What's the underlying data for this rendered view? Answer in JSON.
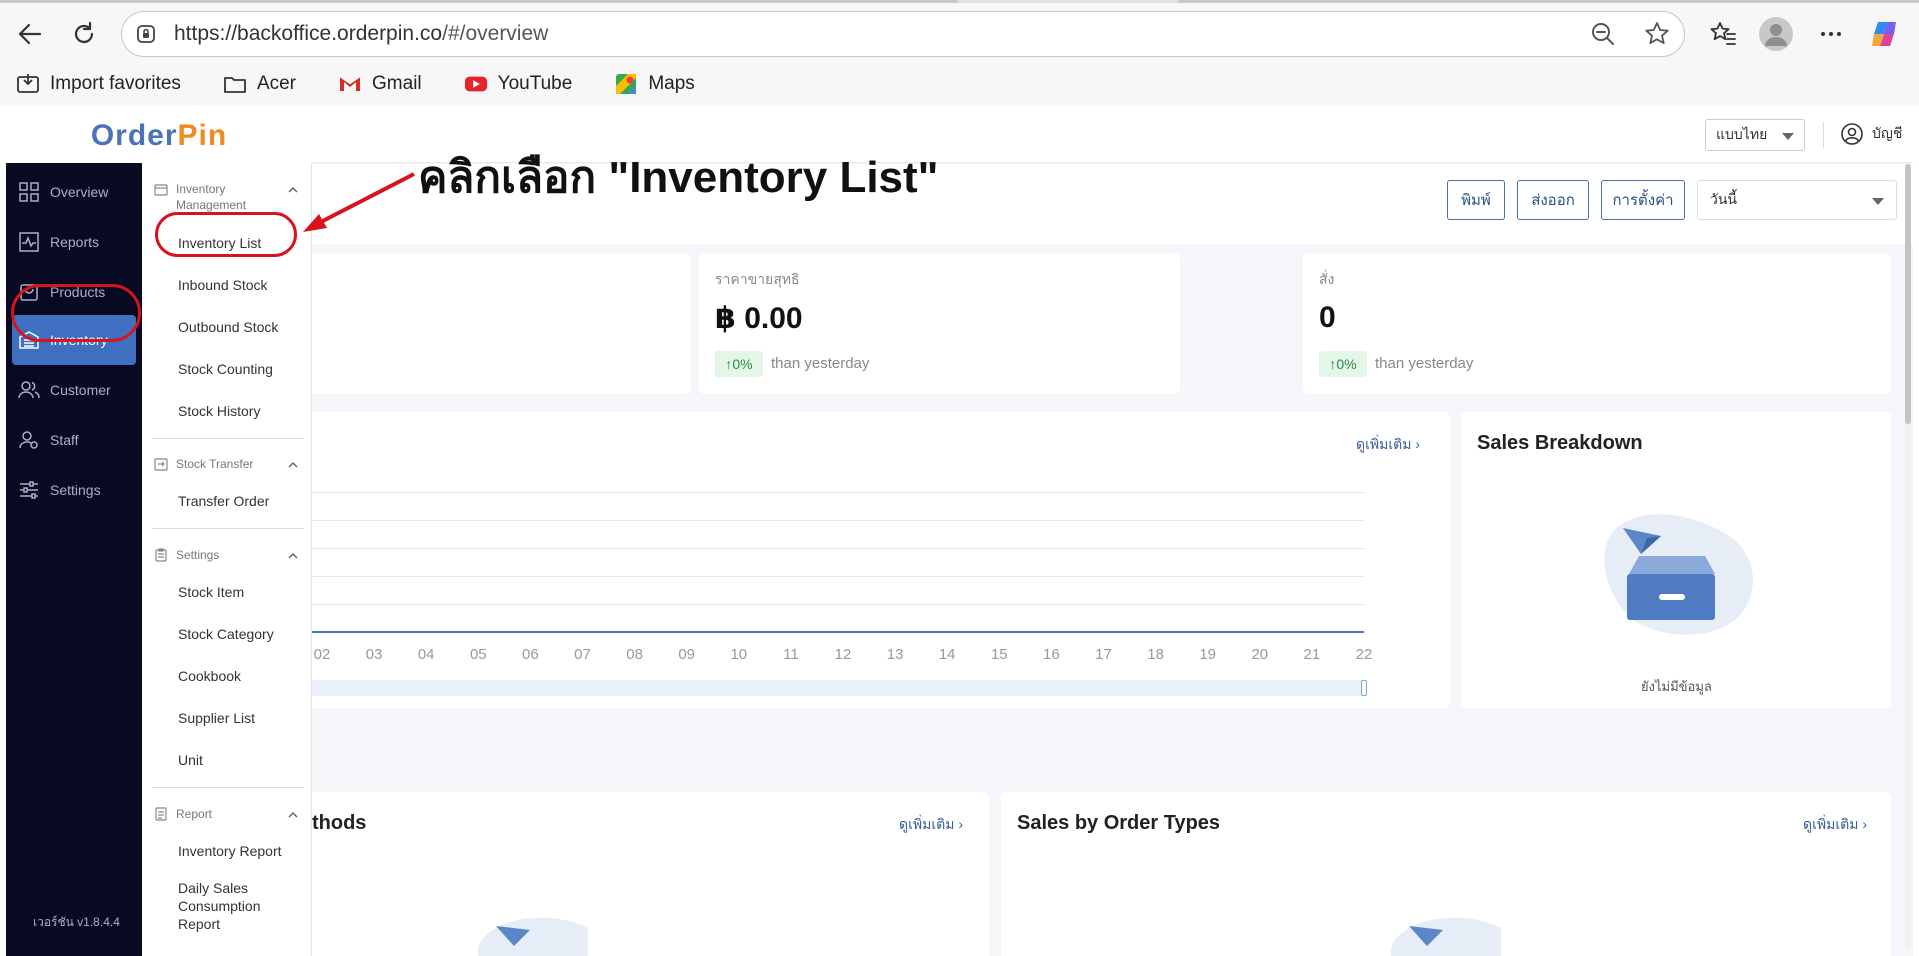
{
  "browser": {
    "url_host": "https://backoffice.orderpin.co",
    "url_path": "/#/overview",
    "bookmarks": [
      {
        "label": "Import favorites",
        "icon": "import-icon"
      },
      {
        "label": "Acer",
        "icon": "folder-icon"
      },
      {
        "label": "Gmail",
        "icon": "gmail-icon"
      },
      {
        "label": "YouTube",
        "icon": "youtube-icon"
      },
      {
        "label": "Maps",
        "icon": "maps-icon"
      }
    ]
  },
  "app": {
    "logo_text_1": "Order",
    "logo_text_2": "Pin",
    "header": {
      "language": "แบบไทย",
      "account": "บัญชี"
    },
    "sidebar": {
      "items": [
        {
          "label": "Overview",
          "icon": "grid-icon"
        },
        {
          "label": "Reports",
          "icon": "chart-icon"
        },
        {
          "label": "Products",
          "icon": "bag-icon"
        },
        {
          "label": "Inventory",
          "icon": "warehouse-icon"
        },
        {
          "label": "Customer",
          "icon": "users-icon"
        },
        {
          "label": "Staff",
          "icon": "staff-icon"
        },
        {
          "label": "Settings",
          "icon": "sliders-icon"
        }
      ],
      "version": "เวอร์ชัน v1.8.4.4"
    },
    "submenu": {
      "inventory_management": {
        "title": "Inventory Management",
        "items": [
          "Inventory List",
          "Inbound Stock",
          "Outbound Stock",
          "Stock Counting",
          "Stock History"
        ]
      },
      "stock_transfer": {
        "title": "Stock Transfer",
        "items": [
          "Transfer Order"
        ]
      },
      "settings": {
        "title": "Settings",
        "items": [
          "Stock Item",
          "Stock Category",
          "Cookbook",
          "Supplier List",
          "Unit"
        ]
      },
      "report": {
        "title": "Report",
        "items": [
          "Inventory Report",
          "Daily Sales Consumption Report"
        ]
      }
    },
    "annotation": "คลิกเลือก \"Inventory List\"",
    "toolbar": {
      "print": "พิมพ์",
      "export": "ส่งออก",
      "settings": "การตั้งค่า",
      "date_range": "วันนี้"
    },
    "stats": [
      {
        "label": "ราคาขายสุทธิ",
        "value": "฿ 0.00",
        "change": "↑0%",
        "note": "than yesterday"
      },
      {
        "label": "สั่ง",
        "value": "0",
        "change": "↑0%",
        "note": "than yesterday"
      }
    ],
    "chart_card": {
      "more": "ดูเพิ่มเติม"
    },
    "sales_breakdown": {
      "title": "Sales Breakdown",
      "empty": "ยังไม่มีข้อมูล"
    },
    "payment_methods": {
      "title_fragment": "thods",
      "more": "ดูเพิ่มเติม"
    },
    "order_types": {
      "title": "Sales by Order Types",
      "more": "ดูเพิ่มเติม"
    }
  },
  "chart_data": {
    "type": "line",
    "categories": [
      "02",
      "03",
      "04",
      "05",
      "06",
      "07",
      "08",
      "09",
      "10",
      "11",
      "12",
      "13",
      "14",
      "15",
      "16",
      "17",
      "18",
      "19",
      "20",
      "21",
      "22"
    ],
    "series": [
      {
        "values": [
          0,
          0,
          0,
          0,
          0,
          0,
          0,
          0,
          0,
          0,
          0,
          0,
          0,
          0,
          0,
          0,
          0,
          0,
          0,
          0,
          0
        ]
      }
    ],
    "grid": true
  }
}
